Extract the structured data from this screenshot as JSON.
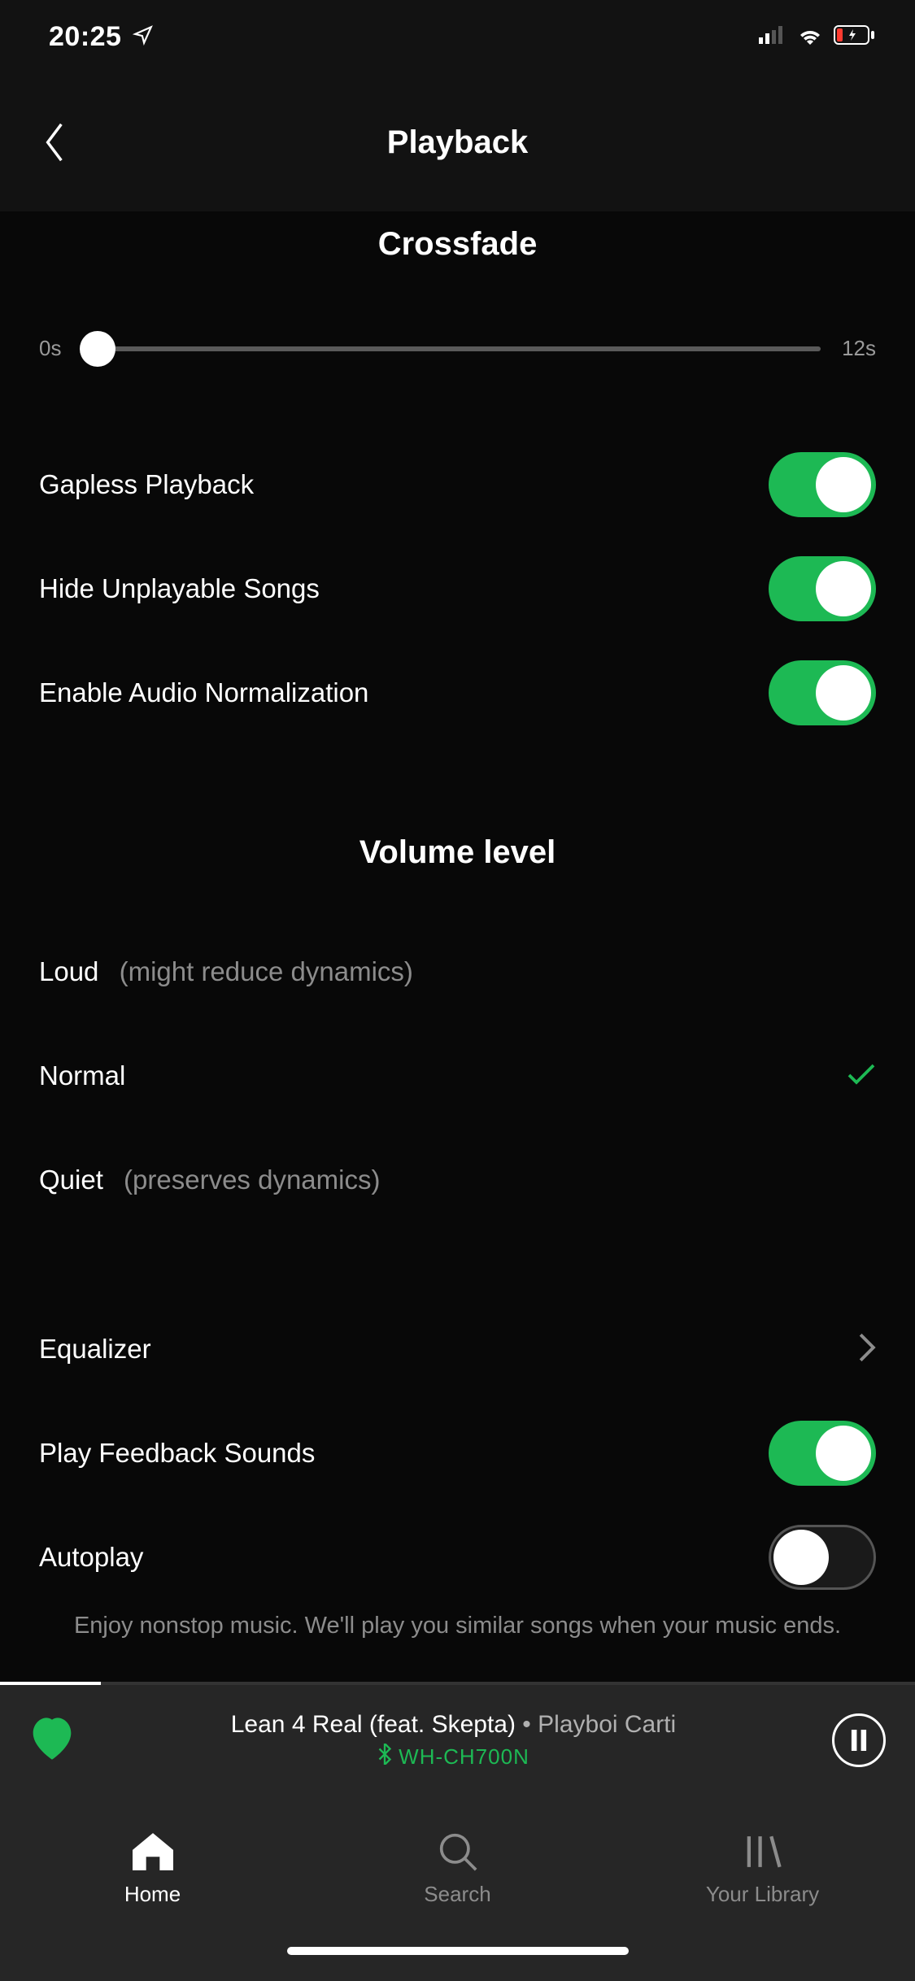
{
  "status": {
    "time": "20:25"
  },
  "nav": {
    "title": "Playback"
  },
  "crossfade": {
    "title": "Crossfade",
    "min_label": "0s",
    "max_label": "12s"
  },
  "toggles": {
    "gapless": {
      "label": "Gapless Playback",
      "on": true
    },
    "hide_unplayable": {
      "label": "Hide Unplayable Songs",
      "on": true
    },
    "audio_norm": {
      "label": "Enable Audio Normalization",
      "on": true
    },
    "feedback": {
      "label": "Play Feedback Sounds",
      "on": true
    },
    "autoplay": {
      "label": "Autoplay",
      "on": false
    }
  },
  "volume": {
    "title": "Volume level",
    "options": [
      {
        "label": "Loud",
        "hint": "(might reduce dynamics)",
        "selected": false
      },
      {
        "label": "Normal",
        "hint": "",
        "selected": true
      },
      {
        "label": "Quiet",
        "hint": "(preserves dynamics)",
        "selected": false
      }
    ]
  },
  "equalizer": {
    "label": "Equalizer"
  },
  "autoplay_desc": "Enjoy nonstop music. We'll play you similar songs when your music ends.",
  "now_playing": {
    "title": "Lean 4 Real (feat. Skepta)",
    "sep": " • ",
    "artist": "Playboi Carti",
    "device": "WH-CH700N"
  },
  "tabs": {
    "home": "Home",
    "search": "Search",
    "library": "Your Library"
  }
}
